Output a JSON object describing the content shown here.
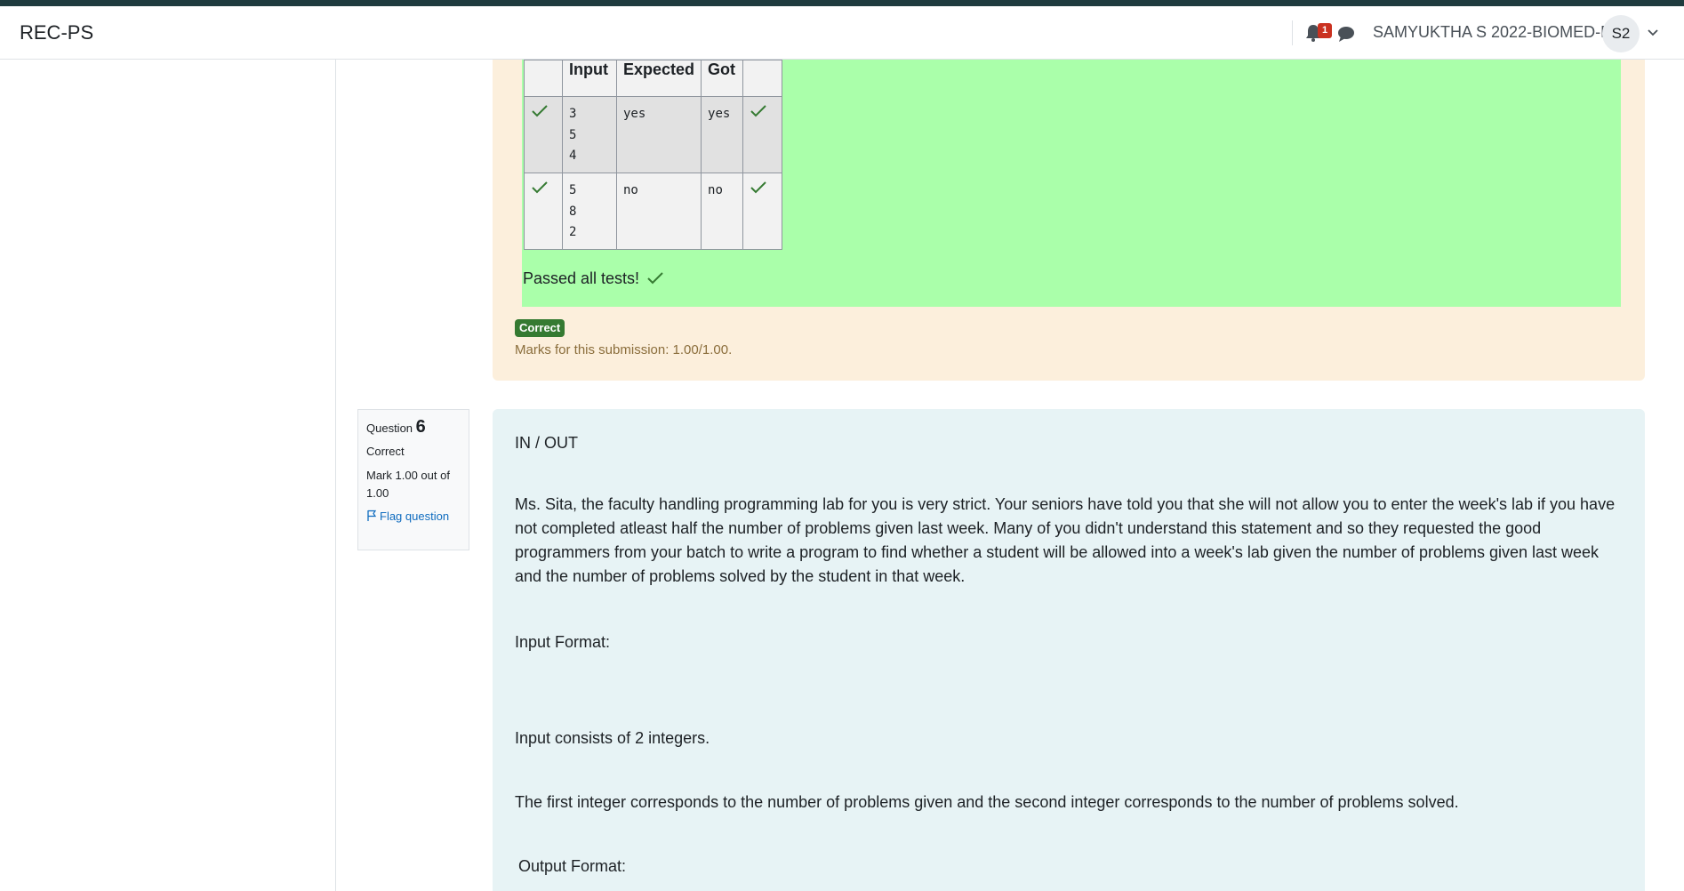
{
  "navbar": {
    "brand": "REC-PS",
    "notification_count": "1",
    "user_name": "SAMYUKTHA S 2022-BIOMED-B",
    "avatar_initials": "S2"
  },
  "previous_answer": {
    "table": {
      "headers": [
        "",
        "Input",
        "Expected",
        "Got",
        ""
      ],
      "rows": [
        {
          "input": [
            "3",
            "5",
            "4"
          ],
          "expected": "yes",
          "got": "yes",
          "passed": true
        },
        {
          "input": [
            "5",
            "8",
            "2"
          ],
          "expected": "no",
          "got": "no",
          "passed": true
        }
      ]
    },
    "passed_text": "Passed all tests!",
    "badge": "Correct",
    "marks": "Marks for this submission: 1.00/1.00."
  },
  "question": {
    "label": "Question",
    "number": "6",
    "state": "Correct",
    "grade": "Mark 1.00 out of 1.00",
    "flag_label": "Flag question",
    "title": "IN / OUT",
    "description": "Ms. Sita, the faculty handling programming lab for you is very strict. Your seniors have told you that she will not allow you to enter the week's lab if you have not completed atleast half the number of problems given last week. Many of you didn't understand this statement and so they requested the good programmers from your batch to write a program to find whether a student will be allowed into a week's lab given the number of problems given last week and the number of problems solved by the student in that week.",
    "input_format_heading": "Input Format:",
    "input_line1": "Input consists of 2 integers.",
    "input_line2": "The first integer corresponds to the number of problems given and the second integer corresponds to the number of problems solved.",
    "output_format_heading": "Output Format:"
  },
  "colors": {
    "pass_green": "#aaffaa",
    "answer_bg": "#fcefdc",
    "question_bg": "#e7f3f5",
    "badge_green": "#357a32",
    "link_blue": "#0f6cbf",
    "top_stripe": "#1f3b3e"
  }
}
